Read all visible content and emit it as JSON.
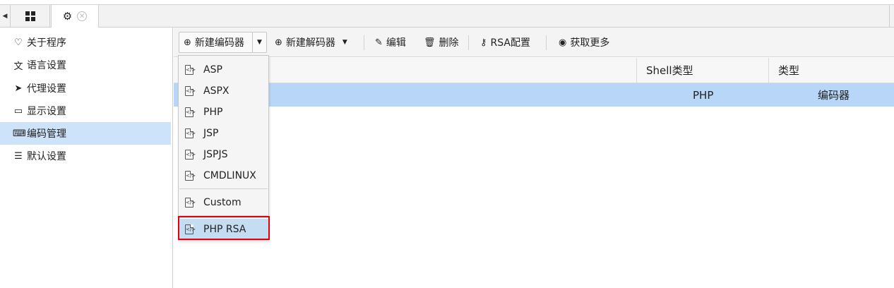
{
  "tabbar": {
    "icons": {
      "scroll_left": "triangle-left-icon",
      "home": "grid-icon",
      "settings": "gear-icon",
      "close": "close-circle-icon"
    },
    "scroll_left_glyph": "◀",
    "settings_glyph": "⚙",
    "close_glyph": "✕"
  },
  "sidebar": {
    "items": [
      {
        "label": "关于程序",
        "icon": "heart-icon",
        "glyph": "♡"
      },
      {
        "label": "语言设置",
        "icon": "language-icon",
        "glyph": "文"
      },
      {
        "label": "代理设置",
        "icon": "paper-plane-icon",
        "glyph": "➤"
      },
      {
        "label": "显示设置",
        "icon": "monitor-icon",
        "glyph": "▭"
      },
      {
        "label": "编码管理",
        "icon": "file-code-icon",
        "glyph": "⌨",
        "selected": true
      },
      {
        "label": "默认设置",
        "icon": "sliders-icon",
        "glyph": "☰"
      }
    ]
  },
  "toolbar": {
    "new_encoder": "新建编码器",
    "new_decoder": "新建解码器",
    "edit": "编辑",
    "delete": "删除",
    "rsa_config": "RSA配置",
    "get_more": "获取更多",
    "glyphs": {
      "plus": "⊕",
      "edit": "✎",
      "trash": "🗑",
      "key": "⚷",
      "chrome": "◉",
      "caret": "▼"
    }
  },
  "grid": {
    "columns": [
      "",
      "Shell类型",
      "类型"
    ],
    "rows": [
      {
        "name": "",
        "shell_type": "PHP",
        "type": "编码器"
      }
    ]
  },
  "dropdown": {
    "items": [
      "ASP",
      "ASPX",
      "PHP",
      "JSP",
      "JSPJS",
      "CMDLINUX"
    ],
    "custom": "Custom",
    "php_rsa": "PHP RSA",
    "file_glyph": "</>",
    "highlight_color": "#e0000d"
  }
}
